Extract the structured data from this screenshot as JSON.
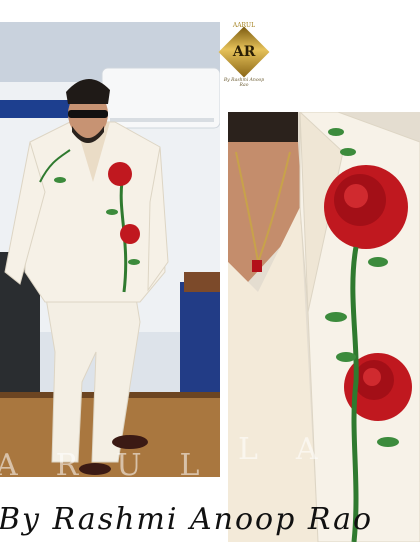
{
  "brand": {
    "logo_top": "AARUL",
    "logo_monogram": "AR",
    "logo_sub": "By Rashmi Anoop Rao"
  },
  "watermark": {
    "left": "ARUL",
    "right": "LA"
  },
  "signature": {
    "text": "By Rashmi Anoop Rao"
  },
  "colors": {
    "suit": "#f4efe4",
    "rose": "#c0181f",
    "stem": "#2f7a2f",
    "logo_gold": "#c9a23a"
  }
}
